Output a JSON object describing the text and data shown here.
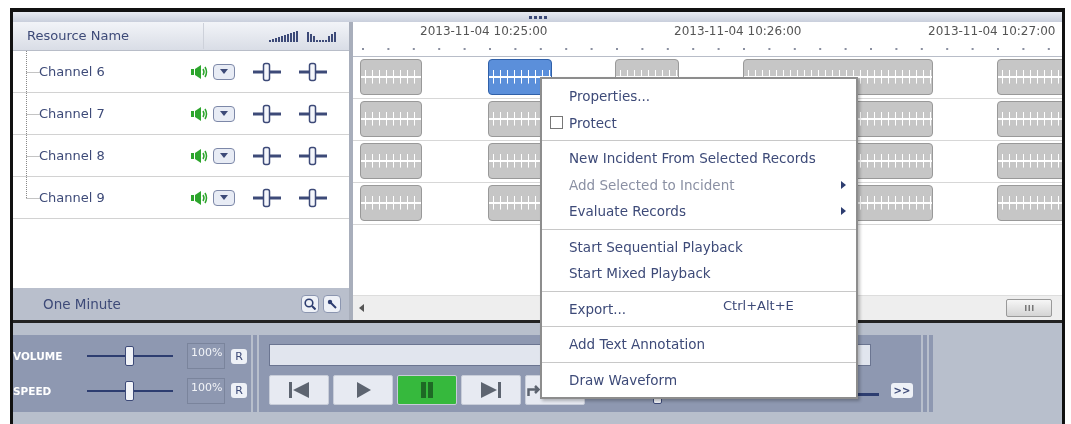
{
  "resource_header": {
    "title": "Resource Name"
  },
  "channels": [
    {
      "name": "Channel 6"
    },
    {
      "name": "Channel 7"
    },
    {
      "name": "Channel 8"
    },
    {
      "name": "Channel 9"
    }
  ],
  "zoom_footer": {
    "label": "One Minute"
  },
  "timeline": {
    "labels": [
      "2013-11-04 10:25:00",
      "2013-11-04 10:26:00",
      "2013-11-04 10:27:00"
    ]
  },
  "tracks": [
    {
      "clips": [
        {
          "selected": false
        },
        {
          "selected": true
        },
        {
          "selected": false
        },
        {
          "selected": false
        },
        {
          "selected": false
        }
      ]
    },
    {
      "clips": [
        {
          "selected": false
        },
        {
          "selected": false
        },
        {
          "selected": false
        },
        {
          "selected": false
        }
      ]
    },
    {
      "clips": [
        {
          "selected": false
        },
        {
          "selected": false
        },
        {
          "selected": false
        },
        {
          "selected": false
        }
      ]
    },
    {
      "clips": [
        {
          "selected": false
        },
        {
          "selected": false
        },
        {
          "selected": false
        },
        {
          "selected": false
        }
      ]
    }
  ],
  "context_menu": [
    {
      "kind": "item",
      "label": "Properties...",
      "disabled": false
    },
    {
      "kind": "checkbox",
      "label": "Protect",
      "checked": false,
      "disabled": false
    },
    {
      "kind": "separator"
    },
    {
      "kind": "item",
      "label": "New Incident From Selected Records",
      "disabled": false
    },
    {
      "kind": "item",
      "label": "Add Selected to Incident",
      "disabled": true,
      "submenu": true
    },
    {
      "kind": "item",
      "label": "Evaluate Records",
      "disabled": false,
      "submenu": true
    },
    {
      "kind": "separator"
    },
    {
      "kind": "item",
      "label": "Start Sequential Playback",
      "disabled": false
    },
    {
      "kind": "item",
      "label": "Start Mixed Playback",
      "disabled": false
    },
    {
      "kind": "separator"
    },
    {
      "kind": "item",
      "label": "Export...",
      "shortcut": "Ctrl+Alt+E",
      "disabled": false
    },
    {
      "kind": "separator"
    },
    {
      "kind": "item",
      "label": "Add Text Annotation",
      "disabled": false
    },
    {
      "kind": "separator"
    },
    {
      "kind": "item",
      "label": "Draw Waveform",
      "disabled": false
    }
  ],
  "playback": {
    "controls": [
      {
        "label": "VOLUME",
        "level": 0.5,
        "value": "100%",
        "reset": "R"
      },
      {
        "label": "SPEED",
        "level": 0.5,
        "value": "100%",
        "reset": "R"
      }
    ],
    "transport": [
      {
        "kind": "previous",
        "selected": false
      },
      {
        "kind": "play",
        "selected": false
      },
      {
        "kind": "pause",
        "selected": true
      },
      {
        "kind": "next",
        "selected": false
      },
      {
        "kind": "repeat",
        "selected": false
      }
    ],
    "position": {
      "level": 0.15
    },
    "forward": ">>"
  }
}
